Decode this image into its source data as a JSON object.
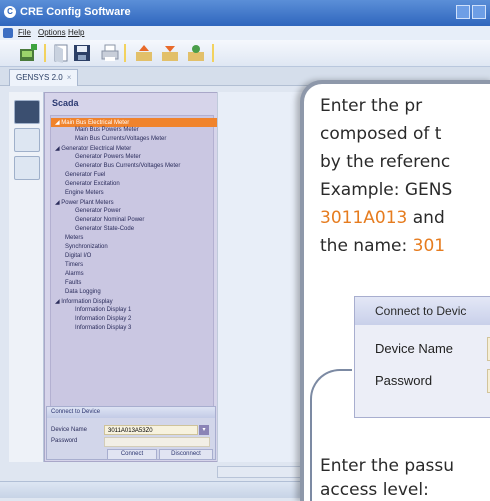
{
  "window": {
    "title": "CRE Config Software"
  },
  "menu": {
    "items": [
      "File",
      "Options",
      "Help"
    ]
  },
  "tabs": [
    {
      "label": "GENSYS 2.0"
    }
  ],
  "panel": {
    "title": "Scada",
    "tree": [
      {
        "label": "Main Bus Electrical Meter",
        "level": 0,
        "expanded": true,
        "selected": true
      },
      {
        "label": "Main Bus Powers Meter",
        "level": 2
      },
      {
        "label": "Main Bus Currents/Voltages Meter",
        "level": 2
      },
      {
        "label": "Generator Electrical Meter",
        "level": 0,
        "expanded": true
      },
      {
        "label": "Generator Powers Meter",
        "level": 2
      },
      {
        "label": "Generator Bus Currents/Voltages Meter",
        "level": 2
      },
      {
        "label": "Generator Fuel",
        "level": 1
      },
      {
        "label": "Generator Excitation",
        "level": 1
      },
      {
        "label": "Engine Meters",
        "level": 1
      },
      {
        "label": "Power Plant Meters",
        "level": 0,
        "expanded": true
      },
      {
        "label": "Generator Power",
        "level": 2
      },
      {
        "label": "Generator Nominal Power",
        "level": 2
      },
      {
        "label": "Generator State-Code",
        "level": 2
      },
      {
        "label": "Meters",
        "level": 1
      },
      {
        "label": "Synchronization",
        "level": 1
      },
      {
        "label": "Digital I/O",
        "level": 1
      },
      {
        "label": "Timers",
        "level": 1
      },
      {
        "label": "Alarms",
        "level": 1
      },
      {
        "label": "Faults",
        "level": 1
      },
      {
        "label": "Data Logging",
        "level": 1
      },
      {
        "label": "Information Display",
        "level": 0,
        "expanded": true
      },
      {
        "label": "Information Display 1",
        "level": 2
      },
      {
        "label": "Information Display 2",
        "level": 2
      },
      {
        "label": "Information Display 3",
        "level": 2
      }
    ]
  },
  "connect": {
    "header": "Connect to Device",
    "device_name_label": "Device Name",
    "device_name_value": "3011A013A53Z0",
    "password_label": "Password",
    "connect_button": "Connect",
    "disconnect_button": "Disconnect"
  },
  "callout": {
    "lines": [
      {
        "parts": [
          {
            "t": "Enter the pr",
            "c": "text"
          }
        ]
      },
      {
        "parts": [
          {
            "t": "composed of t",
            "c": "text"
          }
        ]
      },
      {
        "parts": [
          {
            "t": "by the referenc",
            "c": "text"
          }
        ]
      },
      {
        "parts": [
          {
            "t": "Example: GENS",
            "c": "text"
          }
        ]
      },
      {
        "parts": [
          {
            "t": "3011A013",
            "c": "orange"
          },
          {
            "t": " and",
            "c": "text"
          }
        ]
      },
      {
        "parts": [
          {
            "t": "the name: ",
            "c": "text"
          },
          {
            "t": "301",
            "c": "orange"
          }
        ]
      }
    ],
    "zoom_header": "Connect to Devic",
    "zoom_device_label": "Device Name",
    "zoom_password_label": "Password",
    "bottom_line": "Enter the passu",
    "bottom_line_2": "access level:"
  },
  "colors": {
    "accent_orange": "#e67c1f",
    "selected_orange": "#f0832c",
    "titlebar_blue": "#2f66bd"
  }
}
